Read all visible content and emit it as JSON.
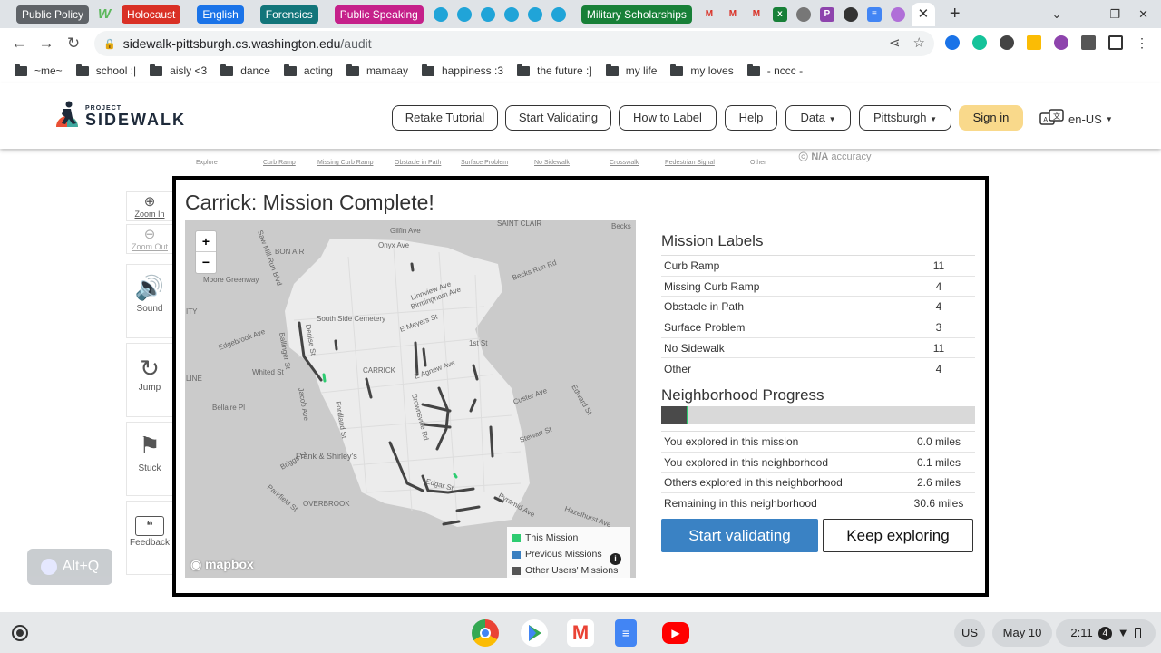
{
  "browser": {
    "tabs": [
      {
        "label": "Public Policy",
        "color": "#5f6368"
      },
      {
        "label": "Holocaust",
        "color": "#d93025"
      },
      {
        "label": "English",
        "color": "#1a73e8"
      },
      {
        "label": "Forensics",
        "color": "#12757a"
      },
      {
        "label": "Public Speaking",
        "color": "#c5208a"
      },
      {
        "label": "Military Scholarships",
        "color": "#188038"
      }
    ],
    "url_host": "sidewalk-pittsburgh.cs.washington.edu",
    "url_path": "/audit",
    "bookmarks": [
      "~me~",
      "school :|",
      "aisly <3",
      "dance",
      "acting",
      "mamaay",
      "happiness :3",
      "the future :]",
      "my life",
      "my loves",
      "- nccc -"
    ]
  },
  "nav": {
    "logo_small": "PROJECT",
    "logo_big": "SIDEWALK",
    "retake_tutorial": "Retake Tutorial",
    "start_validating": "Start Validating",
    "how_to_label": "How to Label",
    "help": "Help",
    "data": "Data",
    "city": "Pittsburgh",
    "sign_in": "Sign in",
    "language": "en-US"
  },
  "audit_strip": {
    "labels": [
      "Explore",
      "Curb Ramp",
      "Missing Curb Ramp",
      "Obstacle in Path",
      "Surface Problem",
      "No Sidewalk",
      "Crosswalk",
      "Pedestrian Signal",
      "Other"
    ],
    "accuracy_value": "N/A",
    "accuracy_label": "accuracy"
  },
  "toolbar": {
    "zoom_in": "Zoom In",
    "zoom_out": "Zoom Out",
    "sound": "Sound",
    "jump": "Jump",
    "stuck": "Stuck",
    "feedback": "Feedback"
  },
  "alt_q": "Alt+Q",
  "modal": {
    "title": "Carrick: Mission Complete!",
    "map": {
      "zoom_in": "+",
      "zoom_out": "−",
      "attribution": "mapbox",
      "place_labels": [
        "SAINT CLAIR",
        "Becks",
        "Gilfin Ave",
        "Onyx Ave",
        "BON AIR",
        "Saw Mill Run Blvd",
        "Moore Greenway",
        "Becks Run Rd",
        "Linnview Ave",
        "Birmingham Ave",
        "South Side Cemetery",
        "E Meyers St",
        "Edgebrook Ave",
        "Denise St",
        "Ballinger St",
        "1st St",
        "CARRICK",
        "E Agnew Ave",
        "Whited St",
        "Brownsville Rd",
        "Custer Ave",
        "Edward St",
        "Bellaire Pl",
        "Jacob Ave",
        "Fordland St",
        "Stewart St",
        "Frank & Shirley's",
        "Briggs St",
        "Parkfield St",
        "Edgar St",
        "OVERBROOK",
        "Pyramid Ave",
        "Hazelhurst Ave",
        "LINE",
        "ITY"
      ],
      "legend": [
        {
          "label": "This Mission",
          "color": "#2ecc71"
        },
        {
          "label": "Previous Missions",
          "color": "#3a7fc0"
        },
        {
          "label": "Other Users' Missions",
          "color": "#555555"
        }
      ]
    },
    "mission_labels_title": "Mission Labels",
    "mission_labels": [
      {
        "label": "Curb Ramp",
        "count": "11"
      },
      {
        "label": "Missing Curb Ramp",
        "count": "4"
      },
      {
        "label": "Obstacle in Path",
        "count": "4"
      },
      {
        "label": "Surface Problem",
        "count": "3"
      },
      {
        "label": "No Sidewalk",
        "count": "11"
      },
      {
        "label": "Other",
        "count": "4"
      }
    ],
    "progress_title": "Neighborhood Progress",
    "progress_fraction": 0.08,
    "progress_stats": [
      {
        "label": "You explored in this mission",
        "value": "0.0 miles"
      },
      {
        "label": "You explored in this neighborhood",
        "value": "0.1 miles"
      },
      {
        "label": "Others explored in this neighborhood",
        "value": "2.6 miles"
      },
      {
        "label": "Remaining in this neighborhood",
        "value": "30.6 miles"
      }
    ],
    "start_validating": "Start validating",
    "keep_exploring": "Keep exploring"
  },
  "shelf": {
    "input_method": "US",
    "date": "May 10",
    "time": "2:11",
    "notifications": "4"
  }
}
